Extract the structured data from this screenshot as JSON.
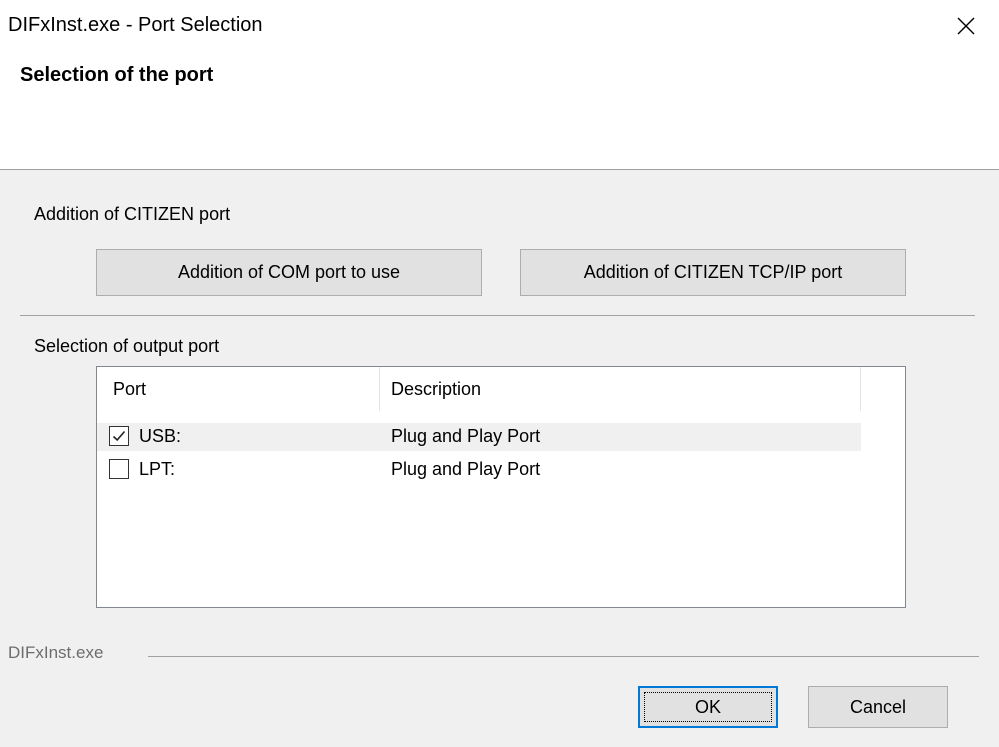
{
  "window": {
    "title": "DIFxInst.exe - Port Selection"
  },
  "header": {
    "title": "Selection of the port"
  },
  "citizen_group": {
    "label": "Addition of CITIZEN port",
    "com_button_label": "Addition of COM port to use",
    "tcp_button_label": "Addition of CITIZEN TCP/IP port"
  },
  "output_group": {
    "label": "Selection of output port",
    "columns": [
      "Port",
      "Description"
    ],
    "rows": [
      {
        "port": "USB:",
        "description": "Plug and Play Port",
        "checked": true
      },
      {
        "port": "LPT:",
        "description": "Plug and Play Port",
        "checked": false
      }
    ]
  },
  "footer": {
    "label": "DIFxInst.exe",
    "ok_label": "OK",
    "cancel_label": "Cancel"
  },
  "icons": {
    "close": "close-icon",
    "check": "check-icon"
  }
}
